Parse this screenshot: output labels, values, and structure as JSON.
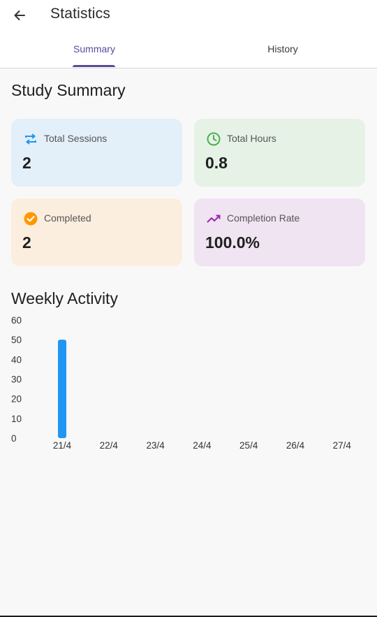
{
  "appbar": {
    "title": "Statistics"
  },
  "tabs": [
    {
      "label": "Summary",
      "active": true
    },
    {
      "label": "History",
      "active": false
    }
  ],
  "summary": {
    "heading": "Study Summary",
    "cards": [
      {
        "label": "Total Sessions",
        "value": "2",
        "icon": "repeat-icon",
        "icon_color": "#2196f3",
        "bg": "#e3eff9"
      },
      {
        "label": "Total Hours",
        "value": "0.8",
        "icon": "clock-icon",
        "icon_color": "#4caf50",
        "bg": "#e6f2e6"
      },
      {
        "label": "Completed",
        "value": "2",
        "icon": "check-circle-icon",
        "icon_color": "#ff9800",
        "bg": "#fbeedf"
      },
      {
        "label": "Completion Rate",
        "value": "100.0%",
        "icon": "trending-up-icon",
        "icon_color": "#9c27b0",
        "bg": "#f0e3f2"
      }
    ]
  },
  "weekly": {
    "heading": "Weekly Activity"
  },
  "chart_data": {
    "type": "bar",
    "title": "",
    "xlabel": "",
    "ylabel": "",
    "categories": [
      "21/4",
      "22/4",
      "23/4",
      "24/4",
      "25/4",
      "26/4",
      "27/4"
    ],
    "values": [
      50,
      0,
      0,
      0,
      0,
      0,
      0
    ],
    "ylim": [
      0,
      60
    ],
    "yticks": [
      0,
      10,
      20,
      30,
      40,
      50,
      60
    ],
    "bar_color": "#2196f3",
    "grid": false
  },
  "colors": {
    "accent": "#5b4a9c"
  }
}
